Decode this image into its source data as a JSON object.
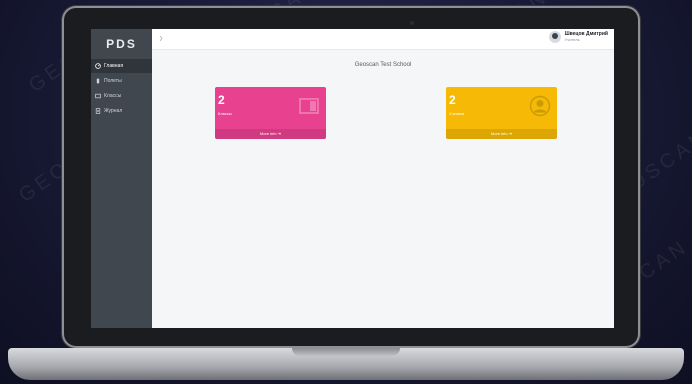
{
  "watermark": "GEOSCAN",
  "sidebar": {
    "logo": "PDS",
    "items": [
      {
        "label": "Главная",
        "icon": "dashboard-icon",
        "active": true
      },
      {
        "label": "Полеты",
        "icon": "flight-icon",
        "active": false
      },
      {
        "label": "Классы",
        "icon": "classes-icon",
        "active": false
      },
      {
        "label": "Журнал",
        "icon": "journal-icon",
        "active": false
      }
    ]
  },
  "topbar": {
    "user_name": "Швецов Дмитрий",
    "user_role": "Учитель"
  },
  "page": {
    "title": "Geoscan Test School"
  },
  "cards": [
    {
      "count": "2",
      "label": "Классы",
      "footer": "More info",
      "color": "#e8418f",
      "icon": "classes-icon"
    },
    {
      "count": "2",
      "label": "Ученики",
      "footer": "More info",
      "color": "#f5b906",
      "icon": "user-icon"
    }
  ]
}
